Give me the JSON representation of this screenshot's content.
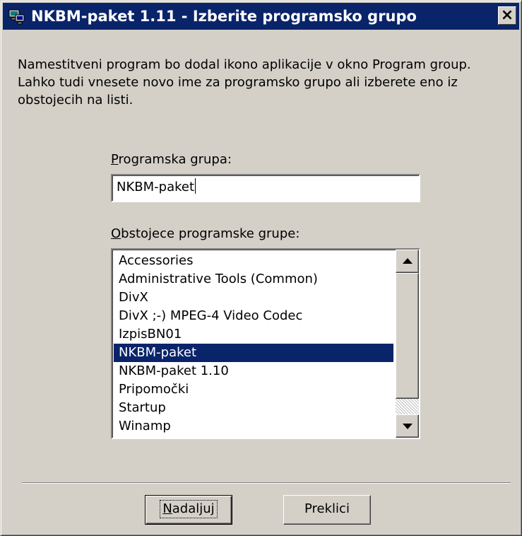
{
  "window": {
    "title": "NKBM-paket 1.11 - Izberite programsko grupo",
    "close_label": "×",
    "title_icon": "setup-computer-icon"
  },
  "description": "Namestitveni program bo dodal ikono aplikacije v okno Program group.\nLahko tudi  vnesete novo ime za programsko grupo ali izberete eno iz\nobstojecih na listi.",
  "program_group": {
    "label_mnemonic": "P",
    "label_rest": "rogramska grupa:",
    "value": "NKBM-paket"
  },
  "existing_groups": {
    "label_mnemonic": "O",
    "label_rest": "bstojece programske grupe:",
    "items": [
      "Accessories",
      "Administrative Tools (Common)",
      "DivX",
      "DivX ;-) MPEG-4 Video Codec",
      "IzpisBN01",
      "NKBM-paket",
      "NKBM-paket 1.10",
      "Pripomočki",
      "Startup",
      "Winamp"
    ],
    "selected_index": 5
  },
  "buttons": {
    "next_mnemonic": "N",
    "next_rest": "adaljuj",
    "cancel_label": "Preklici"
  },
  "colors": {
    "titlebar": "#0a246a",
    "face": "#d4d0c8",
    "selection": "#0a246a"
  }
}
